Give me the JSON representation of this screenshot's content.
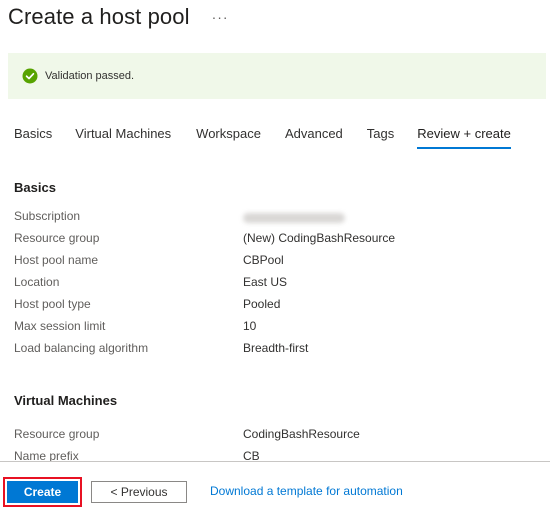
{
  "header": {
    "title": "Create a host pool",
    "more_label": "···"
  },
  "validation": {
    "icon": "check-circle-icon",
    "message": "Validation passed.",
    "color": "#57a300"
  },
  "tabs": [
    {
      "label": "Basics"
    },
    {
      "label": "Virtual Machines"
    },
    {
      "label": "Workspace"
    },
    {
      "label": "Advanced"
    },
    {
      "label": "Tags"
    },
    {
      "label": "Review + create",
      "active": true
    }
  ],
  "basics": {
    "title": "Basics",
    "rows": [
      {
        "label": "Subscription",
        "value": "",
        "redacted": true
      },
      {
        "label": "Resource group",
        "value": "(New) CodingBashResource"
      },
      {
        "label": "Host pool name",
        "value": "CBPool"
      },
      {
        "label": "Location",
        "value": "East US"
      },
      {
        "label": "Host pool type",
        "value": "Pooled"
      },
      {
        "label": "Max session limit",
        "value": "10"
      },
      {
        "label": "Load balancing algorithm",
        "value": "Breadth-first"
      }
    ]
  },
  "virtual_machines": {
    "title": "Virtual Machines",
    "rows": [
      {
        "label": "Resource group",
        "value": "CodingBashResource"
      },
      {
        "label": "Name prefix",
        "value": "CB"
      }
    ]
  },
  "footer": {
    "create_label": "Create",
    "previous_label": "< Previous",
    "template_link": "Download a template for automation"
  },
  "colors": {
    "accent": "#0078d4",
    "highlight_outline": "#e81123",
    "validation_bg": "#f0f8e9"
  }
}
